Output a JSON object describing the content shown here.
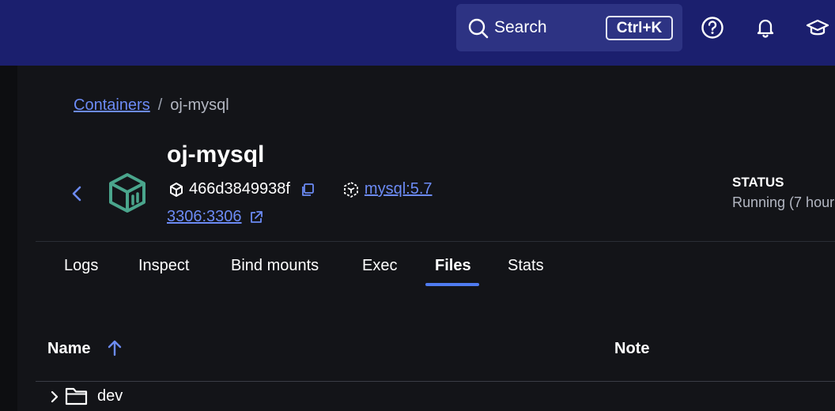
{
  "header": {
    "search_label": "Search",
    "search_shortcut": "Ctrl+K",
    "icons": [
      "search-icon",
      "help-icon",
      "bell-icon",
      "learning-center-icon"
    ]
  },
  "breadcrumb": {
    "parent": "Containers",
    "separator": "/",
    "current": "oj-mysql"
  },
  "container": {
    "name": "oj-mysql",
    "id": "466d3849938f",
    "image": "mysql:5.7",
    "port": "3306:3306",
    "status_label": "STATUS",
    "status_value": "Running (7 hour"
  },
  "tabs": [
    {
      "label": "Logs"
    },
    {
      "label": "Inspect"
    },
    {
      "label": "Bind mounts"
    },
    {
      "label": "Exec"
    },
    {
      "label": "Files",
      "active": true
    },
    {
      "label": "Stats"
    }
  ],
  "files": {
    "columns": {
      "name": "Name",
      "note": "Note"
    },
    "rows": [
      {
        "name": "dev"
      }
    ]
  },
  "colors": {
    "topbar": "#1b1f6e",
    "search_bg": "#2d3383",
    "link": "#6c8bf5",
    "accent": "#4f7bf0",
    "container_icon": "#4aa58c"
  }
}
